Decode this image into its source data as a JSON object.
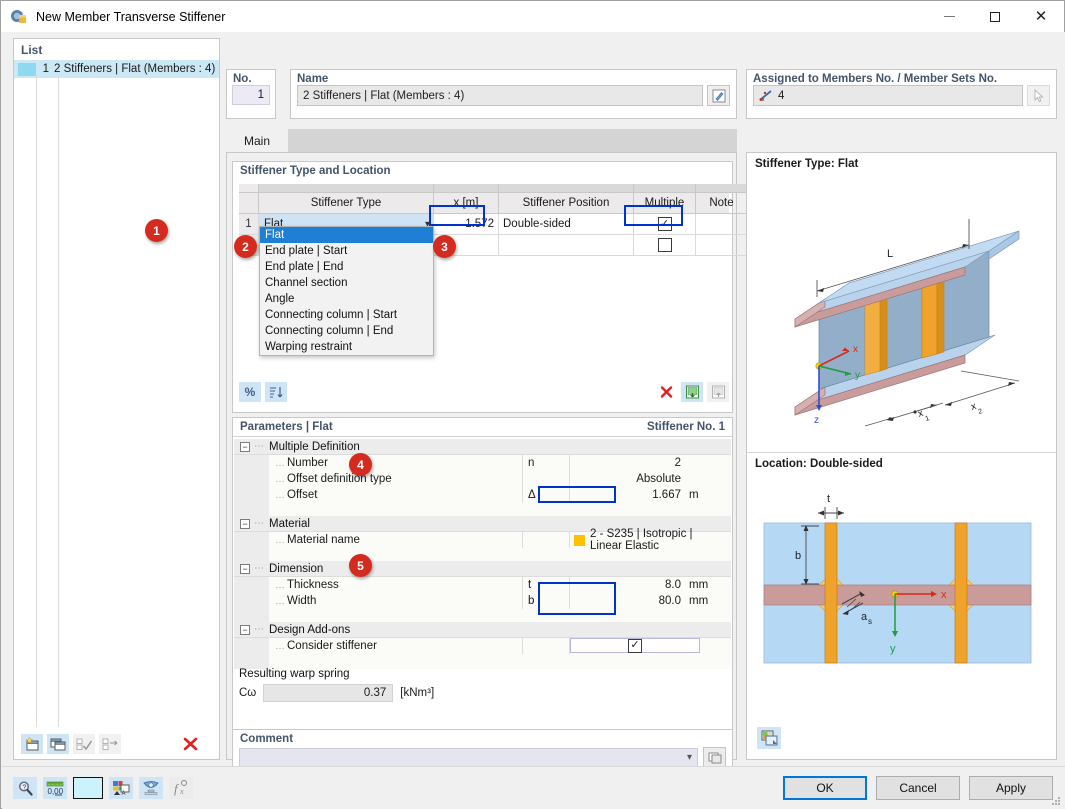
{
  "window": {
    "title": "New Member Transverse Stiffener",
    "icon": "app-icon",
    "minimize": "–",
    "maximize": "□",
    "close": "✕"
  },
  "list_panel": {
    "header": "List",
    "rows": [
      {
        "num": "1",
        "label": "2 Stiffeners | Flat (Members : 4)"
      }
    ],
    "toolbar": [
      {
        "name": "new-item-button",
        "glyph": "⬜",
        "enabled": true
      },
      {
        "name": "copy-item-button",
        "glyph": "❐",
        "enabled": true
      },
      {
        "name": "select-all-button",
        "glyph": "☑",
        "enabled": false
      },
      {
        "name": "invert-selection-button",
        "glyph": "☐",
        "enabled": false
      },
      {
        "name": "delete-item-button",
        "glyph": "✕",
        "enabled": true
      }
    ]
  },
  "no_field": {
    "label": "No.",
    "value": "1"
  },
  "name_field": {
    "label": "Name",
    "value": "2 Stiffeners | Flat (Members : 4)",
    "edit_icon": "pencil-edit-icon"
  },
  "assigned_field": {
    "label": "Assigned to Members No. / Member Sets No.",
    "value": "4",
    "member_icon": "member-line-icon",
    "pick_icon": "pick-cursor-icon"
  },
  "tabs": [
    {
      "label": "Main",
      "active": true
    }
  ],
  "stiffener_group": {
    "title": "Stiffener Type and Location",
    "columns": [
      "",
      "Stiffener Type",
      "x [m]",
      "Stiffener Position",
      "Multiple",
      "Note"
    ],
    "rows": [
      {
        "index": "1",
        "type": "Flat",
        "x": "1.572",
        "position": "Double-sided",
        "multiple": true,
        "note": ""
      },
      {
        "index": "2",
        "type": "",
        "x": "",
        "position": "",
        "multiple": false,
        "note": ""
      }
    ],
    "dropdown_open": true,
    "dropdown_items": [
      "Flat",
      "End plate | Start",
      "End plate | End",
      "Channel section",
      "Angle",
      "Connecting column | Start",
      "Connecting column | End",
      "Warping restraint"
    ],
    "dropdown_selected": "Flat",
    "toolbar": [
      {
        "name": "percent-button",
        "glyph": "%"
      },
      {
        "name": "sort-button",
        "glyph": "↓"
      },
      {
        "name": "delete-row-button",
        "glyph": "✕"
      },
      {
        "name": "export-table-button",
        "glyph": "▦"
      },
      {
        "name": "import-table-button",
        "glyph": "▦"
      }
    ]
  },
  "parameters_group": {
    "title": "Parameters | Flat",
    "title_right": "Stiffener No. 1",
    "sections": [
      {
        "name": "Multiple Definition",
        "rows": [
          {
            "label": "Number",
            "symbol": "n",
            "value": "2",
            "unit": ""
          },
          {
            "label": "Offset definition type",
            "symbol": "",
            "value": "Absolute",
            "unit": ""
          },
          {
            "label": "Offset",
            "symbol": "Δ",
            "value": "1.667",
            "unit": "m"
          }
        ]
      },
      {
        "name": "Material",
        "rows": [
          {
            "label": "Material name",
            "symbol": "",
            "value": "2 - S235 | Isotropic | Linear Elastic",
            "unit": "",
            "swatch": "#ffc000"
          }
        ]
      },
      {
        "name": "Dimension",
        "rows": [
          {
            "label": "Thickness",
            "symbol": "t",
            "value": "8.0",
            "unit": "mm"
          },
          {
            "label": "Width",
            "symbol": "b",
            "value": "80.0",
            "unit": "mm"
          }
        ]
      },
      {
        "name": "Design Add-ons",
        "rows": [
          {
            "label": "Consider stiffener",
            "symbol": "",
            "value": "",
            "unit": "",
            "checkbox": true
          }
        ]
      }
    ],
    "warp": {
      "title": "Resulting warp spring",
      "symbol": "Cω",
      "value": "0.37",
      "unit": "[kNm³]"
    }
  },
  "comment_group": {
    "title": "Comment",
    "value": "",
    "dropdown_icon": "chevron-down-icon",
    "copy_icon": "comment-library-icon"
  },
  "preview": {
    "top_title": "Stiffener Type: Flat",
    "bottom_title": "Location: Double-sided",
    "top_labels": {
      "length": "L",
      "axis_x": "x",
      "axis_y": "y",
      "axis_z": "z",
      "x1": "x",
      "x1_sub": "1",
      "x2": "x",
      "x2_sub": "2"
    },
    "bottom_labels": {
      "t": "t",
      "b": "b",
      "a": "a",
      "a_sub": "s",
      "axis_x": "x",
      "axis_y": "y"
    },
    "render_icon": "render-image-icon",
    "colors": {
      "flange": "#a8c6e8",
      "web": "#93aec9",
      "stiffener": "#f0a32a",
      "plate": "#c99b9b",
      "panel": "#b5d9f5"
    }
  },
  "badges": [
    "1",
    "2",
    "3",
    "4",
    "5"
  ],
  "bottom_toolbar": [
    {
      "name": "help-search-icon",
      "glyph": "⚲"
    },
    {
      "name": "units-icon",
      "glyph": "0,00"
    },
    {
      "name": "color-swatch-icon",
      "glyph": ""
    },
    {
      "name": "display-properties-icon",
      "glyph": "▦"
    },
    {
      "name": "visibility-icon",
      "glyph": "◉"
    },
    {
      "name": "formula-icon",
      "glyph": "f"
    }
  ],
  "dialog_buttons": {
    "ok": "OK",
    "cancel": "Cancel",
    "apply": "Apply"
  }
}
